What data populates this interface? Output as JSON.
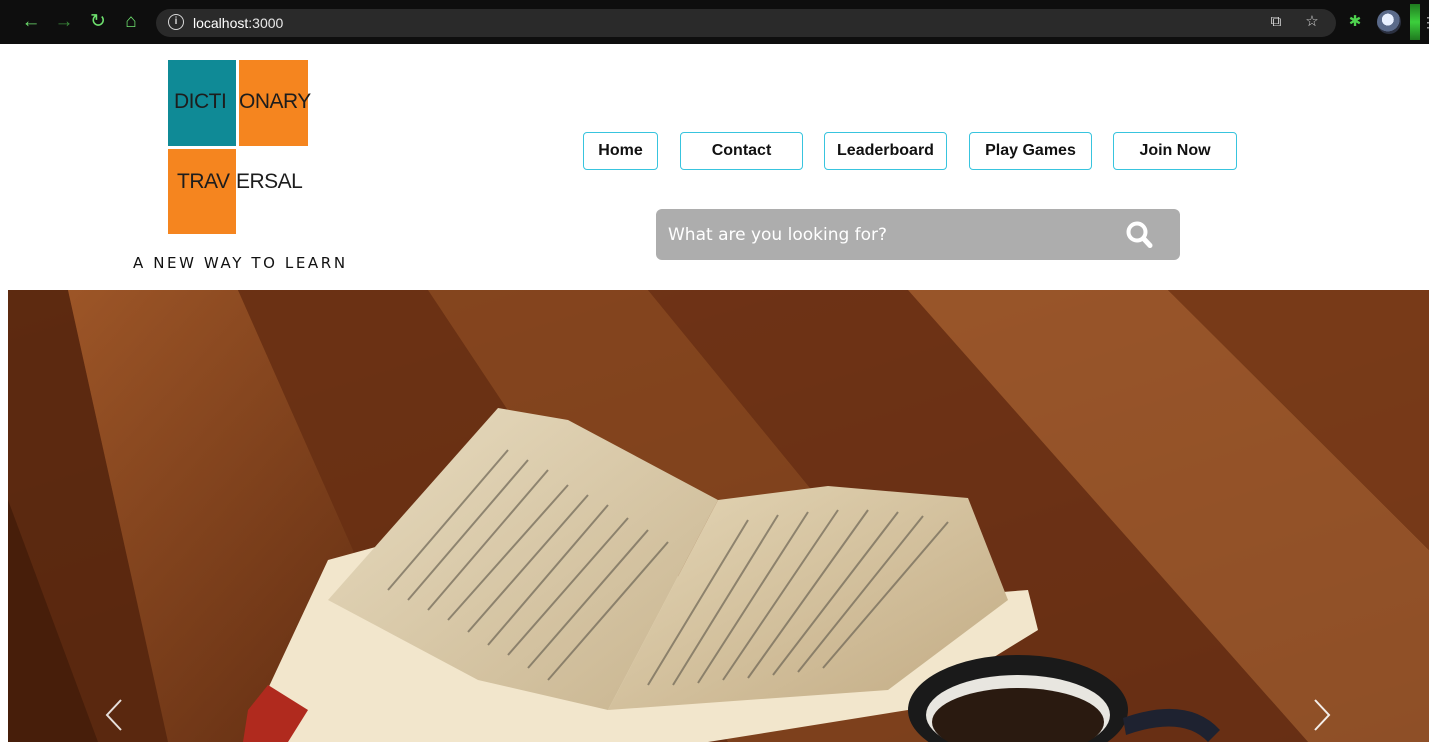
{
  "browser": {
    "url_host": "localhost",
    "url_port": ":3000"
  },
  "logo": {
    "word1_part1": "DICTI",
    "word1_part2": "ONARY",
    "word2_part1": "TRAV",
    "word2_part2": "ERSAL",
    "tagline": "A NEW WAY TO LEARN",
    "colors": {
      "teal": "#0f8a96",
      "orange": "#f5851f"
    }
  },
  "nav": {
    "items": [
      {
        "label": "Home"
      },
      {
        "label": "Contact"
      },
      {
        "label": "Leaderboard"
      },
      {
        "label": "Play Games"
      },
      {
        "label": "Join Now"
      }
    ],
    "border_color": "#38c4de"
  },
  "search": {
    "placeholder": "What are you looking for?",
    "icon": "search-icon"
  },
  "hero": {
    "icons": [
      "chevron-left-icon",
      "chevron-right-icon"
    ]
  }
}
